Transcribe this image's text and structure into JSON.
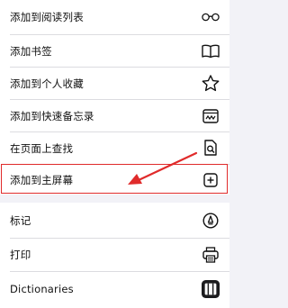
{
  "menu": {
    "section1": [
      {
        "label": "添加到阅读列表",
        "icon": "reading-list-glasses-icon"
      },
      {
        "label": "添加书签",
        "icon": "book-open-icon"
      },
      {
        "label": "添加到个人收藏",
        "icon": "star-icon"
      },
      {
        "label": "添加到快速备忘录",
        "icon": "quick-note-icon"
      },
      {
        "label": "在页面上查找",
        "icon": "find-on-page-icon"
      },
      {
        "label": "添加到主屏幕",
        "icon": "plus-square-icon"
      }
    ],
    "section2": [
      {
        "label": "标记",
        "icon": "markup-pen-icon"
      },
      {
        "label": "打印",
        "icon": "printer-icon"
      },
      {
        "label": "Dictionaries",
        "icon": "dictionaries-app-icon"
      }
    ]
  },
  "annotation": {
    "highlight_color": "#e02b2b",
    "highlight_target": "添加到主屏幕"
  }
}
